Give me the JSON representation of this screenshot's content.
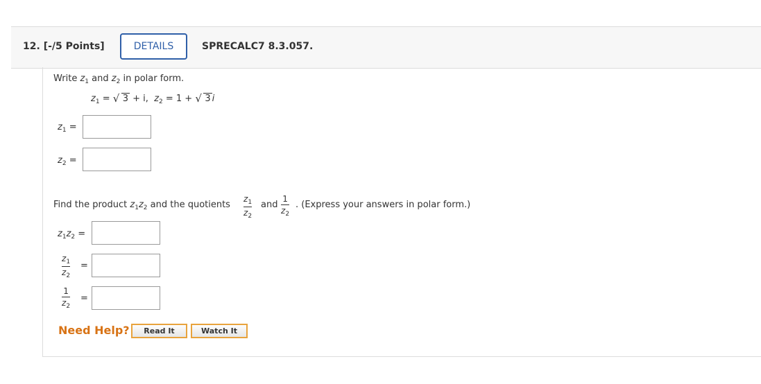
{
  "question": {
    "number": "12.",
    "points": "[-/5 Points]",
    "details_label": "DETAILS",
    "code": "SPRECALC7 8.3.057."
  },
  "part1": {
    "instruction_pre": "Write",
    "instruction_var1": "z",
    "instruction_sub1": "1",
    "instruction_and": "and",
    "instruction_var2": "z",
    "instruction_sub2": "2",
    "instruction_post": "in polar form.",
    "eq_z1_var": "z",
    "eq_z1_sub": "1",
    "eq_z1_rhs_pre": " = ",
    "eq_z1_sqrt": "3",
    "eq_z1_rhs_post": " + i,",
    "eq_z2_var": "z",
    "eq_z2_sub": "2",
    "eq_z2_rhs_pre": " = 1 + ",
    "eq_z2_sqrt": "3",
    "eq_z2_rhs_post": "i",
    "z1_label": "z",
    "z1_sub": "1",
    "z2_label": "z",
    "z2_sub": "2",
    "equals": "="
  },
  "part2": {
    "instruction_pre": "Find the product",
    "product_var": "z",
    "product_sub1": "1",
    "product_sub2": "2",
    "instruction_mid": "and the quotients",
    "and": "and",
    "instruction_post": ". (Express your answers in polar form.)",
    "quot_num_var": "z",
    "quot_num_sub": "1",
    "quot_den_var": "z",
    "quot_den_sub": "2",
    "recip_num": "1",
    "recip_den_var": "z",
    "recip_den_sub": "2",
    "equals": "="
  },
  "footer": {
    "need_help": "Need Help?",
    "read_it": "Read It",
    "watch_it": "Watch It"
  },
  "colors": {
    "details_border": "#2f5fa8",
    "need_help": "#d87315",
    "button_border": "#e8a33d"
  }
}
